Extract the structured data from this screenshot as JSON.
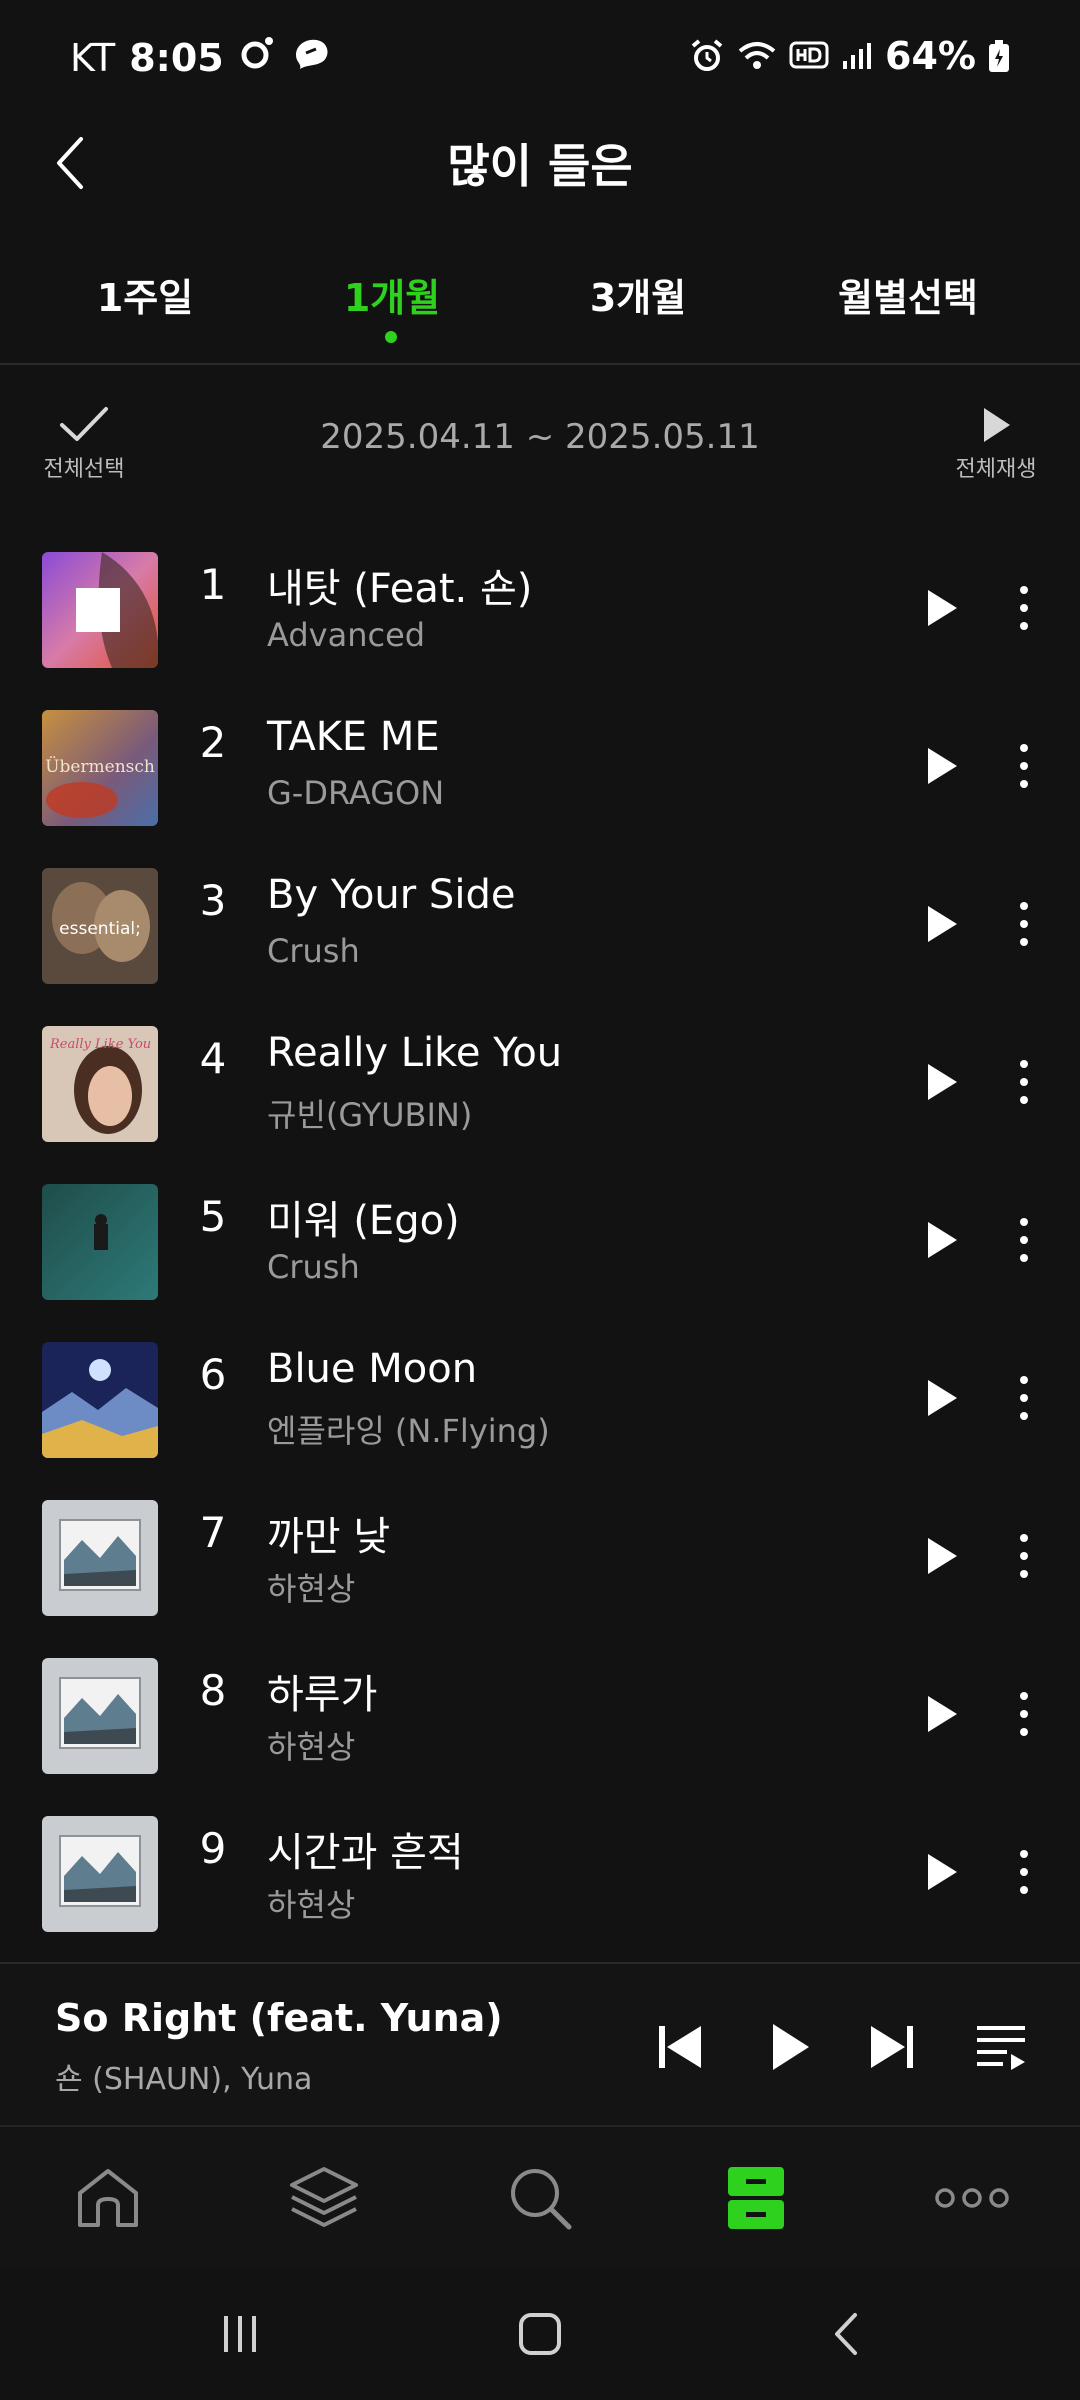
{
  "status_bar": {
    "carrier": "KT",
    "time": "8:05",
    "battery": "64%"
  },
  "header": {
    "title": "많이 들은"
  },
  "tabs": [
    {
      "label": "1주일",
      "active": false
    },
    {
      "label": "1개월",
      "active": true
    },
    {
      "label": "3개월",
      "active": false
    },
    {
      "label": "월별선택",
      "active": false
    }
  ],
  "toolbar": {
    "select_all_label": "전체선택",
    "date_range": "2025.04.11 ~ 2025.05.11",
    "play_all_label": "전체재생"
  },
  "tracks": [
    {
      "rank": "1",
      "title": "내탓 (Feat. 숀)",
      "artist": "Advanced"
    },
    {
      "rank": "2",
      "title": "TAKE ME",
      "artist": "G-DRAGON"
    },
    {
      "rank": "3",
      "title": "By Your Side",
      "artist": "Crush"
    },
    {
      "rank": "4",
      "title": "Really Like You",
      "artist": "규빈(GYUBIN)"
    },
    {
      "rank": "5",
      "title": "미워 (Ego)",
      "artist": "Crush"
    },
    {
      "rank": "6",
      "title": "Blue Moon",
      "artist": "엔플라잉 (N.Flying)"
    },
    {
      "rank": "7",
      "title": "까만 낮",
      "artist": "하현상"
    },
    {
      "rank": "8",
      "title": "하루가",
      "artist": "하현상"
    },
    {
      "rank": "9",
      "title": "시간과 흔적",
      "artist": "하현상"
    }
  ],
  "covers": {
    "c2_text": "Übermensch",
    "c3_text": "essential;",
    "c4_text": "Really Like You"
  },
  "mini_player": {
    "title": "So Right (feat. Yuna)",
    "artist": "숀 (SHAUN), Yuna"
  },
  "colors": {
    "accent": "#2ed11e",
    "background": "#121212",
    "secondary_text": "#9a9a9a"
  }
}
